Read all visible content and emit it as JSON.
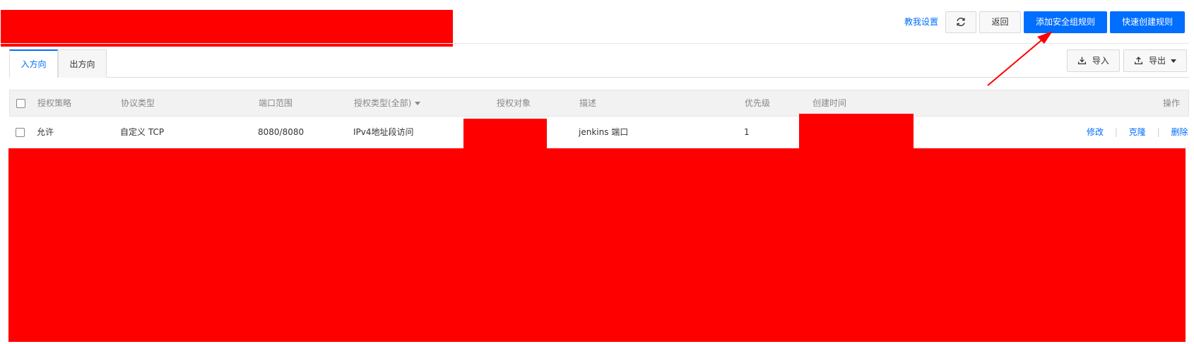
{
  "header": {
    "tutorial_link": "教我设置",
    "refresh_icon": "refresh-icon",
    "back_label": "返回",
    "add_rule_label": "添加安全组规则",
    "quick_create_label": "快速创建规则"
  },
  "tabs": [
    {
      "label": "入方向",
      "active": true
    },
    {
      "label": "出方向",
      "active": false
    }
  ],
  "toolbar": {
    "import_label": "导入",
    "import_icon": "download-icon",
    "export_label": "导出",
    "export_icon": "upload-icon"
  },
  "table": {
    "columns": {
      "policy": "授权策略",
      "protocol": "协议类型",
      "port": "端口范围",
      "auth_type": "授权类型(全部)",
      "target": "授权对象",
      "description": "描述",
      "priority": "优先级",
      "created": "创建时间",
      "actions": "操作"
    },
    "rows": [
      {
        "policy": "允许",
        "protocol": "自定义 TCP",
        "port": "8080/8080",
        "auth_type": "IPv4地址段访问",
        "description": "jenkins 端口",
        "priority": "1",
        "actions": [
          "修改",
          "克隆",
          "删除"
        ]
      }
    ]
  },
  "colors": {
    "accent": "#006eff",
    "redaction": "#ff0000",
    "annotation_arrow": "#ff0000"
  }
}
